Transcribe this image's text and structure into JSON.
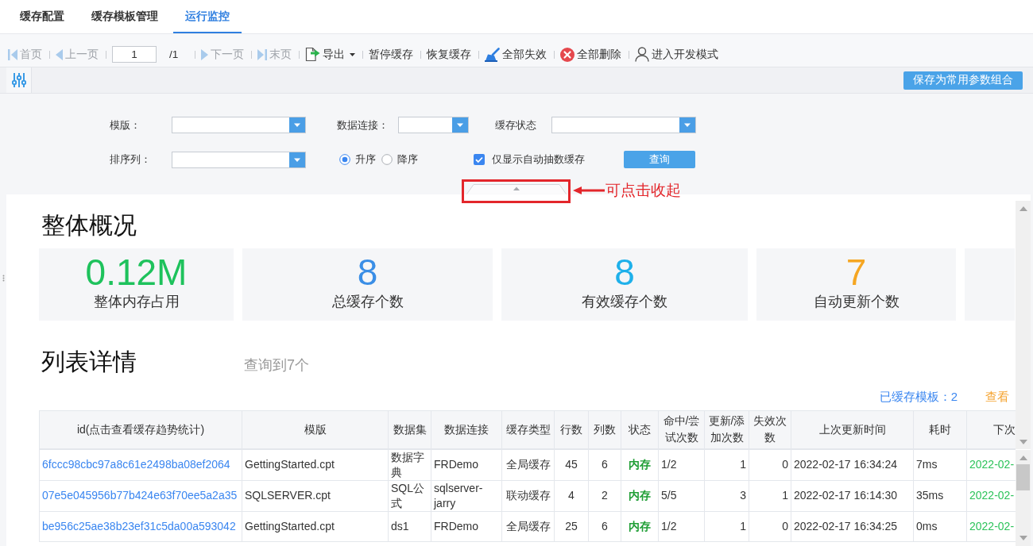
{
  "tabs": [
    {
      "label": "缓存配置",
      "selected": false
    },
    {
      "label": "缓存模板管理",
      "selected": false
    },
    {
      "label": "运行监控",
      "selected": true
    }
  ],
  "toolbar": {
    "items": [
      {
        "kind": "first",
        "label": "首页",
        "disabled": true
      },
      {
        "kind": "prev",
        "label": "上一页",
        "disabled": true
      },
      {
        "kind": "page",
        "value": "1",
        "total": "/1"
      },
      {
        "kind": "next",
        "label": "下一页",
        "disabled": true
      },
      {
        "kind": "last",
        "label": "末页",
        "disabled": true
      },
      {
        "kind": "export",
        "label": "导出",
        "disabled": false
      },
      {
        "kind": "plain",
        "label": "暂停缓存",
        "disabled": false
      },
      {
        "kind": "plain",
        "label": "恢复缓存",
        "disabled": false
      },
      {
        "kind": "broom",
        "label": "全部失效",
        "disabled": false
      },
      {
        "kind": "delete",
        "label": "全部删除",
        "disabled": false
      },
      {
        "kind": "user",
        "label": "进入开发模式",
        "disabled": false
      }
    ]
  },
  "param_bar": {
    "save_button": "保存为常用参数组合"
  },
  "filters": {
    "fields": [
      {
        "label": "模版："
      },
      {
        "label": "数据连接："
      },
      {
        "label": "缓存状态"
      },
      {
        "label": "排序列："
      }
    ],
    "sort_order": [
      {
        "label": "升序",
        "selected": true
      },
      {
        "label": "降序",
        "selected": false
      }
    ],
    "auto_only": {
      "label": "仅显示自动抽数缓存",
      "checked": true
    },
    "query_button": "查询"
  },
  "annotation": {
    "text": "可点击收起"
  },
  "overview": {
    "title": "整体概况",
    "cards": [
      {
        "value": "0.12M",
        "label": "整体内存占用",
        "color": "#1ec25c"
      },
      {
        "value": "8",
        "label": "总缓存个数",
        "color": "#3a8ee6"
      },
      {
        "value": "8",
        "label": "有效缓存个数",
        "color": "#1eb0ea"
      },
      {
        "value": "7",
        "label": "自动更新个数",
        "color": "#f5a623"
      }
    ]
  },
  "list": {
    "title": "列表详情",
    "result_count": "查询到7个",
    "cached_templates": "已缓存模板：2",
    "view_link": "查看"
  },
  "table": {
    "columns": [
      {
        "label": "id(点击查看缓存趋势统计)",
        "kind": "link"
      },
      {
        "label": "模版",
        "kind": "text"
      },
      {
        "label": "数据集",
        "kind": "text"
      },
      {
        "label": "数据连接",
        "kind": "text"
      },
      {
        "label": "缓存类型",
        "kind": "center"
      },
      {
        "label": "行数",
        "kind": "center"
      },
      {
        "label": "列数",
        "kind": "center"
      },
      {
        "label": "状态",
        "kind": "status"
      },
      {
        "label": "命中/尝试次数",
        "kind": "text"
      },
      {
        "label": "更新/添加次数",
        "kind": "number"
      },
      {
        "label": "失效次数",
        "kind": "number"
      },
      {
        "label": "上次更新时间",
        "kind": "text"
      },
      {
        "label": "耗时",
        "kind": "text"
      },
      {
        "label": "下次",
        "kind": "upcoming"
      }
    ],
    "rows": [
      [
        "6fccc98cbc97a8c61e2498ba08ef2064",
        "GettingStarted.cpt",
        "数据字典",
        "FRDemo",
        "全局缓存",
        "45",
        "6",
        "内存",
        "1/2",
        "1",
        "0",
        "2022-02-17 16:34:24",
        "7ms",
        "2022-02-"
      ],
      [
        "07e5e045956b77b424e63f70ee5a2a35",
        "SQLSERVER.cpt",
        "SQL公式",
        "sqlserver-jarry",
        "联动缓存",
        "4",
        "2",
        "内存",
        "5/5",
        "3",
        "1",
        "2022-02-17 16:14:30",
        "35ms",
        "2022-02-"
      ],
      [
        "be956c25ae38b23ef31c5da00a593042",
        "GettingStarted.cpt",
        "ds1",
        "FRDemo",
        "全局缓存",
        "25",
        "6",
        "内存",
        "1/2",
        "1",
        "0",
        "2022-02-17 16:34:25",
        "0ms",
        "2022-02-"
      ]
    ]
  }
}
